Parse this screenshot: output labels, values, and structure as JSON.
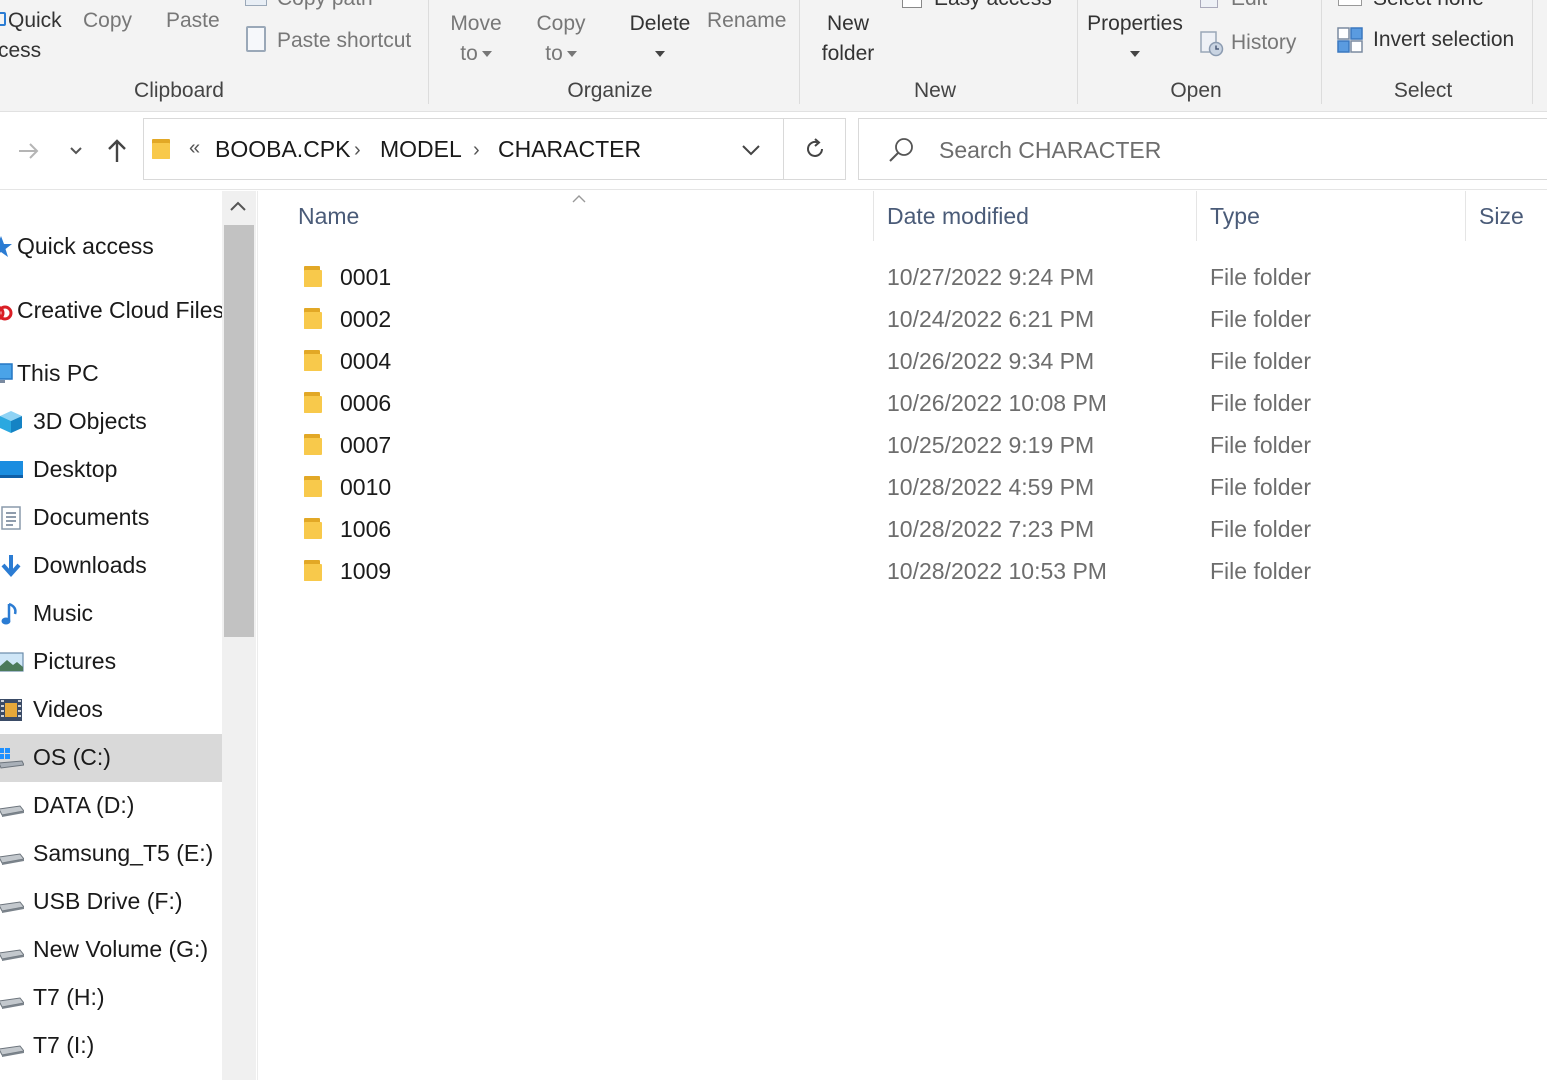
{
  "ribbon": {
    "clipboard": {
      "quick_access_line1": "Quick",
      "quick_access_line2": "cess",
      "copy": "Copy",
      "paste": "Paste",
      "copy_path": "Copy path",
      "paste_shortcut": "Paste shortcut",
      "group_label": "Clipboard"
    },
    "organize": {
      "move_line1": "Move",
      "move_line2": "to",
      "copy_line1": "Copy",
      "copy_line2": "to",
      "delete": "Delete",
      "rename": "Rename",
      "group_label": "Organize"
    },
    "new": {
      "new_folder_line1": "New",
      "new_folder_line2": "folder",
      "easy_access": "Easy access",
      "group_label": "New"
    },
    "open": {
      "properties": "Properties",
      "edit": "Edit",
      "history": "History",
      "group_label": "Open"
    },
    "select": {
      "select_none": "Select none",
      "invert_selection": "Invert selection",
      "group_label": "Select"
    }
  },
  "address": {
    "overflow": "«",
    "crumbs": [
      "BOOBA.CPK",
      "MODEL",
      "CHARACTER"
    ],
    "search_placeholder": "Search CHARACTER"
  },
  "nav": {
    "items": [
      {
        "label": "Quick access",
        "icon": "star-icon"
      },
      {
        "label": "Creative Cloud Files",
        "icon": "creative-cloud-icon"
      },
      {
        "label": "This PC",
        "icon": "computer-icon"
      },
      {
        "label": "3D Objects",
        "icon": "cube-icon"
      },
      {
        "label": "Desktop",
        "icon": "desktop-icon"
      },
      {
        "label": "Documents",
        "icon": "document-icon"
      },
      {
        "label": "Downloads",
        "icon": "download-arrow-icon"
      },
      {
        "label": "Music",
        "icon": "music-note-icon"
      },
      {
        "label": "Pictures",
        "icon": "picture-icon"
      },
      {
        "label": "Videos",
        "icon": "film-icon"
      },
      {
        "label": "OS (C:)",
        "icon": "windows-drive-icon"
      },
      {
        "label": "DATA (D:)",
        "icon": "drive-icon"
      },
      {
        "label": "Samsung_T5 (E:)",
        "icon": "drive-icon"
      },
      {
        "label": "USB Drive (F:)",
        "icon": "drive-icon"
      },
      {
        "label": "New Volume (G:)",
        "icon": "drive-icon"
      },
      {
        "label": "T7 (H:)",
        "icon": "drive-icon"
      },
      {
        "label": "T7 (I:)",
        "icon": "drive-icon"
      }
    ],
    "selected": "OS (C:)"
  },
  "columns": {
    "name": "Name",
    "date": "Date modified",
    "type": "Type",
    "size": "Size"
  },
  "files": [
    {
      "name": "0001",
      "date": "10/27/2022 9:24 PM",
      "type": "File folder"
    },
    {
      "name": "0002",
      "date": "10/24/2022 6:21 PM",
      "type": "File folder"
    },
    {
      "name": "0004",
      "date": "10/26/2022 9:34 PM",
      "type": "File folder"
    },
    {
      "name": "0006",
      "date": "10/26/2022 10:08 PM",
      "type": "File folder"
    },
    {
      "name": "0007",
      "date": "10/25/2022 9:19 PM",
      "type": "File folder"
    },
    {
      "name": "0010",
      "date": "10/28/2022 4:59 PM",
      "type": "File folder"
    },
    {
      "name": "1006",
      "date": "10/28/2022 7:23 PM",
      "type": "File folder"
    },
    {
      "name": "1009",
      "date": "10/28/2022 10:53 PM",
      "type": "File folder"
    }
  ],
  "colors": {
    "folder_yellow": "#f8c94b",
    "folder_dark": "#e2a826",
    "accent_blue": "#2b7cd3",
    "header_text": "#4a5b78",
    "selected_bg": "#d9d9d9"
  }
}
